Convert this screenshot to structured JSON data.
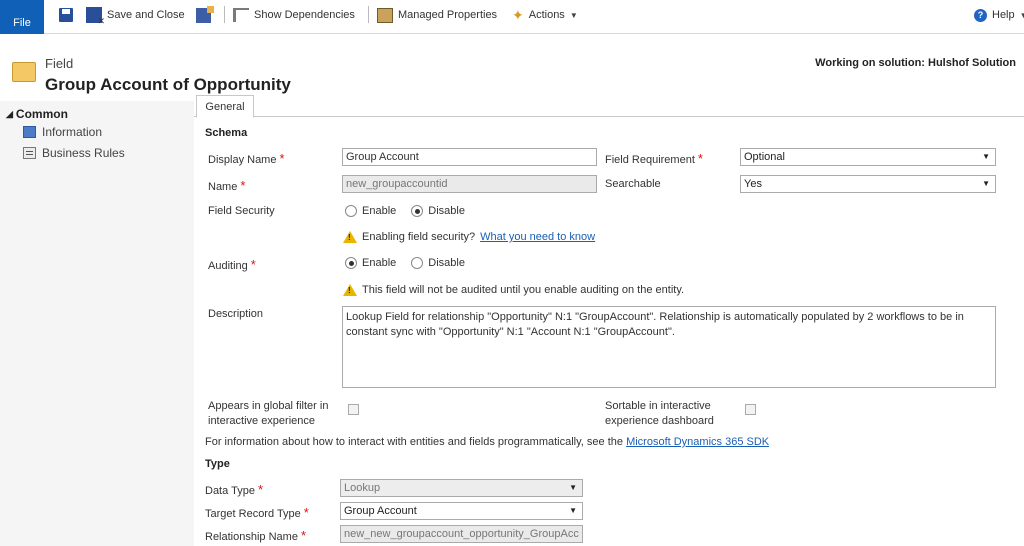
{
  "ribbon": {
    "file": "File",
    "save_close": "Save and Close",
    "show_dependencies": "Show Dependencies",
    "managed_properties": "Managed Properties",
    "actions": "Actions",
    "help": "Help"
  },
  "header": {
    "entity_type": "Field",
    "title": "Group Account of Opportunity",
    "solution": "Working on solution: Hulshof Solution"
  },
  "nav": {
    "section": "Common",
    "items": [
      {
        "label": "Information"
      },
      {
        "label": "Business Rules"
      }
    ]
  },
  "tabs": [
    {
      "label": "General"
    }
  ],
  "schema": {
    "heading": "Schema",
    "display_name_label": "Display Name",
    "display_name_value": "Group Account",
    "name_label": "Name",
    "name_value": "new_groupaccountid",
    "field_requirement_label": "Field Requirement",
    "field_requirement_value": "Optional",
    "searchable_label": "Searchable",
    "searchable_value": "Yes",
    "field_security_label": "Field Security",
    "enable": "Enable",
    "disable": "Disable",
    "security_warning": "Enabling field security?",
    "security_link": "What you need to know",
    "auditing_label": "Auditing",
    "auditing_warning": "This field will not be audited until you enable auditing on the entity.",
    "description_label": "Description",
    "description_value": "Lookup Field for relationship \"Opportunity\" N:1 \"GroupAccount\". Relationship is automatically populated by 2 workflows to be in constant sync with \"Opportunity\" N:1 \"Account N:1 \"GroupAccount\".",
    "global_filter_label_1": "Appears in global filter in",
    "global_filter_label_2": "interactive experience",
    "sortable_label_1": "Sortable in interactive",
    "sortable_label_2": "experience dashboard",
    "sdk_text": "For information about how to interact with entities and fields programmatically, see the",
    "sdk_link": "Microsoft Dynamics 365 SDK"
  },
  "type": {
    "heading": "Type",
    "data_type_label": "Data Type",
    "data_type_value": "Lookup",
    "target_record_label": "Target Record Type",
    "target_record_value": "Group Account",
    "relationship_label": "Relationship Name",
    "relationship_value": "new_new_groupaccount_opportunity_GroupAccou"
  }
}
